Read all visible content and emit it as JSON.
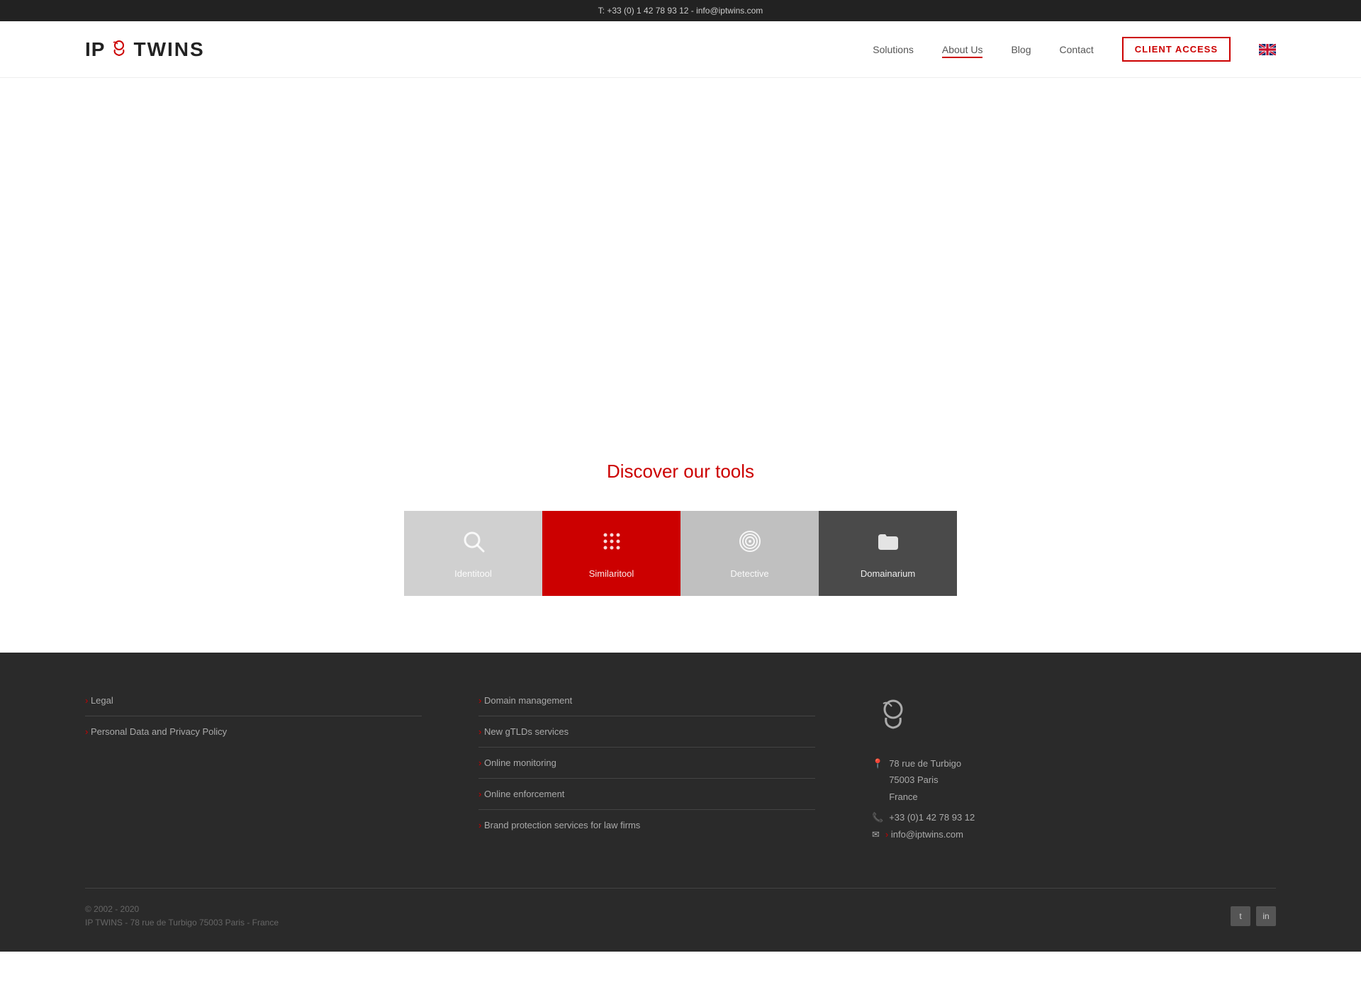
{
  "topbar": {
    "text": "T: +33 (0) 1 42 78 93 12 - info@iptwins.com"
  },
  "header": {
    "logo_ip": "IP",
    "logo_twins": "TWINS",
    "nav": {
      "solutions": "Solutions",
      "about": "About Us",
      "blog": "Blog",
      "contact": "Contact",
      "client_access": "CLIENT ACCESS"
    }
  },
  "discover": {
    "title": "Discover our tools",
    "tools": [
      {
        "name": "Identitool",
        "icon": "🔍",
        "style": "light-gray"
      },
      {
        "name": "Similaritool",
        "icon": "⠿",
        "style": "red"
      },
      {
        "name": "Detective",
        "icon": "👁",
        "style": "mid-gray"
      },
      {
        "name": "Domainarium",
        "icon": "📁",
        "style": "dark-gray"
      }
    ]
  },
  "footer": {
    "col1": {
      "links": [
        {
          "label": "Legal"
        },
        {
          "label": "Personal Data and Privacy Policy"
        }
      ]
    },
    "col2": {
      "links": [
        {
          "label": "Domain management"
        },
        {
          "label": "New gTLDs services"
        },
        {
          "label": "Online monitoring"
        },
        {
          "label": "Online enforcement"
        },
        {
          "label": "Brand protection services for law firms"
        }
      ]
    },
    "contact": {
      "address_line1": "78 rue de Turbigo",
      "address_line2": "75003 Paris",
      "address_line3": "France",
      "phone": "+33 (0)1 42 78 93 12",
      "email": "info@iptwins.com"
    },
    "bottom": {
      "copyright_line1": "© 2002 - 2020",
      "copyright_line2": "IP TWINS - 78 rue de Turbigo 75003 Paris - France"
    },
    "socials": [
      {
        "label": "Twitter",
        "icon": "t"
      },
      {
        "label": "LinkedIn",
        "icon": "in"
      }
    ]
  }
}
